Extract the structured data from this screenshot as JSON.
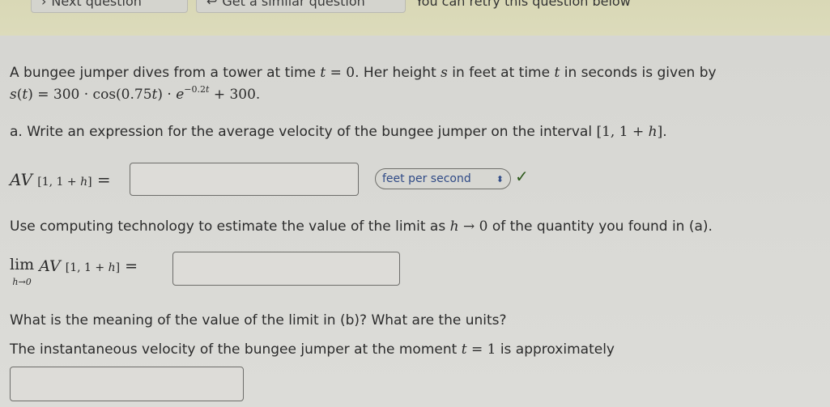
{
  "toolbar": {
    "next_question_label": "Next question",
    "similar_question_label": "Get a similar question",
    "retry_note": "You can retry this question below"
  },
  "problem": {
    "intro_text": "A bungee jumper dives from a tower at time t = 0. Her height s in feet at time t in seconds is given by",
    "formula": "s(t) = 300 · cos(0.75t) · e^(−0.2t) + 300.",
    "part_a_prompt": "a. Write an expression for the average velocity of the bungee jumper on the interval [1, 1 + h].",
    "part_a_label": "AV [1,1+h] =",
    "part_a_value": "",
    "units_select": {
      "selected": "feet per second",
      "status": "correct"
    },
    "part_b_prompt": "Use computing technology to estimate the value of the limit as h → 0 of the quantity you found in (a).",
    "part_b_label": "lim h→0 AV [1,1+h] =",
    "part_b_value": "",
    "part_c_prompt": "What is the meaning of the value of the limit in (b)? What are the units?",
    "part_c_sentence": "The instantaneous velocity of the bungee jumper at the moment t = 1 is approximately",
    "part_c_value": ""
  },
  "icons": {
    "next": "arrow-right-icon",
    "similar": "return-arrow-icon",
    "select": "up-down-chevron-icon",
    "status": "checkmark-icon"
  }
}
